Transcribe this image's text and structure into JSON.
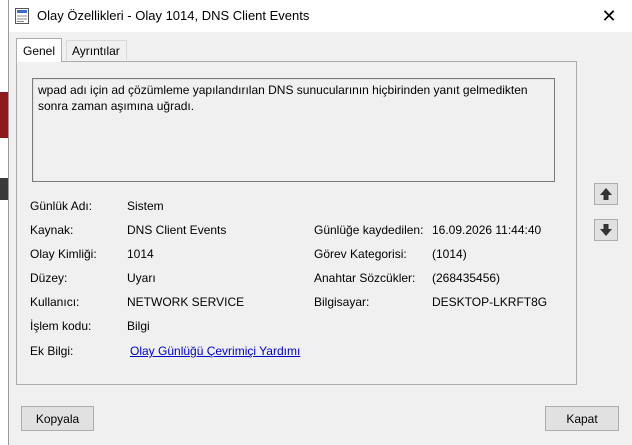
{
  "window": {
    "title": "Olay Özellikleri - Olay 1014, DNS Client Events",
    "close_glyph": "✕"
  },
  "tabs": [
    {
      "label": "Genel",
      "active": true
    },
    {
      "label": "Ayrıntılar",
      "active": false
    }
  ],
  "description": "wpad adı için ad çözümleme yapılandırılan DNS sunucularının hiçbirinden yanıt gelmedikten sonra zaman aşımına uğradı.",
  "fields": {
    "log_name": {
      "label": "Günlük Adı:",
      "value": "Sistem"
    },
    "source": {
      "label": "Kaynak:",
      "value": "DNS Client Events"
    },
    "logged": {
      "label": "Günlüğe kaydedilen:",
      "value": "16.09.2026 11:44:40"
    },
    "event_id": {
      "label": "Olay Kimliği:",
      "value": "1014"
    },
    "task_category": {
      "label": "Görev Kategorisi:",
      "value": "(1014)"
    },
    "level": {
      "label": "Düzey:",
      "value": "Uyarı"
    },
    "keywords": {
      "label": "Anahtar Sözcükler:",
      "value": "(268435456)"
    },
    "user": {
      "label": "Kullanıcı:",
      "value": "NETWORK SERVICE"
    },
    "computer": {
      "label": "Bilgisayar:",
      "value": "DESKTOP-LKRFT8G"
    },
    "opcode": {
      "label": "İşlem kodu:",
      "value": "Bilgi"
    },
    "more_info": {
      "label": "Ek Bilgi:",
      "value": "Olay Günlüğü Çevrimiçi Yardımı"
    }
  },
  "buttons": {
    "copy": "Kopyala",
    "close": "Kapat"
  },
  "icons": {
    "window": "event-properties-icon",
    "up": "up-arrow-icon",
    "down": "down-arrow-icon"
  },
  "colors": {
    "link": "#0000cc",
    "background": "#f0f0f0"
  }
}
